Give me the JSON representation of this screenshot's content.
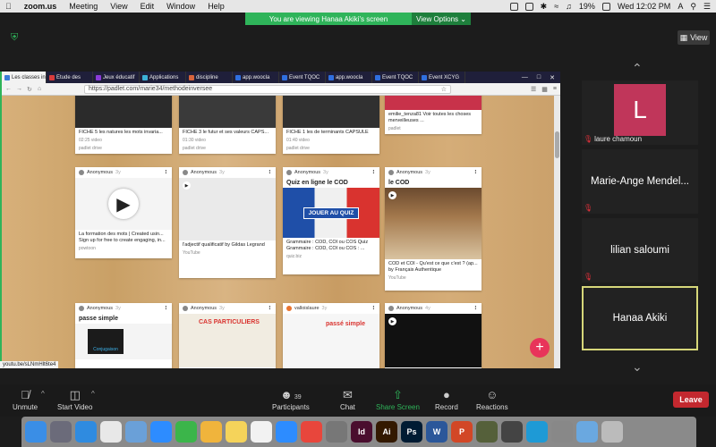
{
  "menubar": {
    "app": "zoom.us",
    "items": [
      "Meeting",
      "View",
      "Edit",
      "Window",
      "Help"
    ],
    "battery": "19%",
    "clock": "Wed 12:02 PM",
    "input_source": "A"
  },
  "banner": {
    "message": "You are viewing Hanaa Akiki's screen",
    "view_options": "View Options ⌄"
  },
  "view_button": "View",
  "browser": {
    "tabs": [
      {
        "label": "Les classes in",
        "color": "#3b7dd8"
      },
      {
        "label": "Etude des",
        "color": "#d83b3b"
      },
      {
        "label": "Jeux éducatif",
        "color": "#8a3bd8"
      },
      {
        "label": "Applications",
        "color": "#3bb0d8"
      },
      {
        "label": "discipline",
        "color": "#d8633b"
      },
      {
        "label": "app.woocla",
        "color": "#2f6fe0"
      },
      {
        "label": "Event TQOC",
        "color": "#2f6fe0"
      },
      {
        "label": "app.woocla",
        "color": "#2f6fe0"
      },
      {
        "label": "Event TQOC",
        "color": "#2f6fe0"
      },
      {
        "label": "Event XCYG",
        "color": "#2f6fe0"
      }
    ],
    "url": "https://padlet.com/marie34/methodeinversee",
    "status_url": "youtu.be/sLNmHlt6te4"
  },
  "cards": [
    {
      "author": "",
      "title": "",
      "caption": "FICHE 5 les natures les mots invaria...",
      "meta": "02:25 video",
      "source": "padlet drive"
    },
    {
      "author": "",
      "title": "",
      "caption": "FICHE 3 le futur et ses valeurs CAPS...",
      "meta": "01:30 video",
      "source": "padlet drive"
    },
    {
      "author": "",
      "title": "",
      "caption": "FICHE 1 les de terminants CAPSULE",
      "meta": "01:40 video",
      "source": "padlet drive"
    },
    {
      "author": "",
      "title": "",
      "caption": "emilie_tenza81 Voir toutes les choses merveilleuses ...",
      "meta": "",
      "source": "padlet"
    },
    {
      "author": "Anonymous",
      "time": "3y",
      "title": "",
      "caption": "La formation des mots | Created usin... Sign up for free to create engaging, in...",
      "source": "powtoon"
    },
    {
      "author": "Anonymous",
      "time": "3y",
      "title": "",
      "caption": "l'adjectif qualificatif by Gildas Legrand",
      "source": "YouTube"
    },
    {
      "author": "Anonymous",
      "time": "3y",
      "title": "Quiz en ligne le COD",
      "caption": "Grammaire : COD, COI ou COS Quiz Grammaire : COD, COI ou COS : ...",
      "source": "quiz.biz",
      "button": "JOUER AU QUIZ"
    },
    {
      "author": "Anonymous",
      "time": "3y",
      "title": "le COD",
      "caption": "COD et COI - Qu'est ce que c'est ? (ap... by Français Authentique",
      "source": "YouTube"
    },
    {
      "author": "Anonymous",
      "time": "3y",
      "title": "passe simple",
      "caption": "",
      "source": "",
      "thumb_text": "Conjugaison"
    },
    {
      "author": "Anonymous",
      "time": "3y",
      "title": "",
      "caption": "",
      "source": "",
      "thumb_text": "CAS PARTICULIERS"
    },
    {
      "author": "valloislaure",
      "time": "3y",
      "title": "",
      "caption": "",
      "source": "",
      "thumb_text": "passé simple"
    },
    {
      "author": "Anonymous",
      "time": "4y",
      "title": "",
      "caption": "",
      "source": ""
    }
  ],
  "participants": [
    {
      "name": "laure chamoun",
      "initial": "L",
      "muted": true
    },
    {
      "name": "Marie-Ange Mendel...",
      "muted": true
    },
    {
      "name": "lilian saloumi",
      "muted": true
    },
    {
      "name": "Hanaa Akiki",
      "muted": false,
      "active": true
    }
  ],
  "toolbar": {
    "unmute": "Unmute",
    "start_video": "Start Video",
    "participants": "Participants",
    "participant_count": "39",
    "chat": "Chat",
    "share_screen": "Share Screen",
    "record": "Record",
    "reactions": "Reactions",
    "leave": "Leave"
  },
  "dock": [
    {
      "name": "finder",
      "color": "#3a8ee6"
    },
    {
      "name": "launchpad",
      "color": "#6b6b7a"
    },
    {
      "name": "safari",
      "color": "#2f8be0"
    },
    {
      "name": "chrome",
      "color": "#e8e8e8"
    },
    {
      "name": "preview",
      "color": "#6aa0d8"
    },
    {
      "name": "zoom",
      "color": "#2d8cff"
    },
    {
      "name": "facetime",
      "color": "#3bb54a"
    },
    {
      "name": "photos",
      "color": "#f0b43c"
    },
    {
      "name": "notes",
      "color": "#f5d35a"
    },
    {
      "name": "music",
      "color": "#f2f2f2"
    },
    {
      "name": "app-store",
      "color": "#2d8cff"
    },
    {
      "name": "anydesk",
      "color": "#e8463c"
    },
    {
      "name": "system-preferences",
      "color": "#777"
    },
    {
      "name": "indesign",
      "color": "#4a0e2e",
      "label": "Id"
    },
    {
      "name": "illustrator",
      "color": "#331900",
      "label": "Ai"
    },
    {
      "name": "photoshop",
      "color": "#001b33",
      "label": "Ps"
    },
    {
      "name": "word",
      "color": "#2b579a",
      "label": "W"
    },
    {
      "name": "powerpoint",
      "color": "#d24726",
      "label": "P"
    },
    {
      "name": "game",
      "color": "#55603a"
    },
    {
      "name": "teams",
      "color": "#444"
    },
    {
      "name": "accessibility",
      "color": "#1e9ad6"
    },
    {
      "name": "automator",
      "color": "#888"
    },
    {
      "name": "downloads",
      "color": "#6aa8e0"
    },
    {
      "name": "trash",
      "color": "#bbb"
    }
  ]
}
